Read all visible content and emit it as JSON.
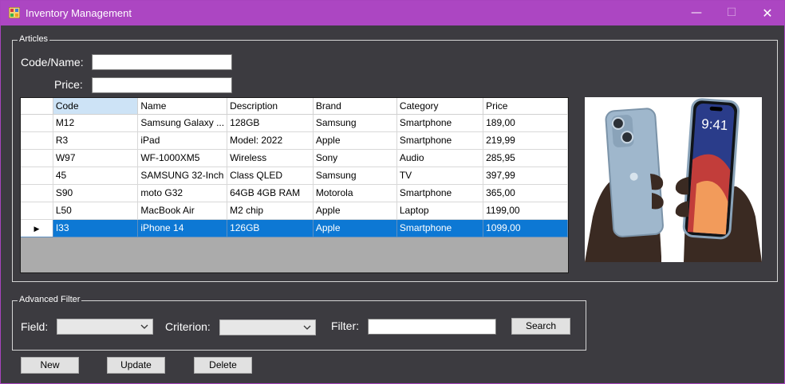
{
  "window": {
    "title": "Inventory Management",
    "controls": {
      "minimize": "—",
      "maximize": "☐",
      "close": "✕"
    }
  },
  "articles": {
    "group_title": "Articles",
    "code_name_label": "Code/Name:",
    "code_name_value": "",
    "price_label": "Price:",
    "price_value": "",
    "grid": {
      "columns": [
        "Code",
        "Name",
        "Description",
        "Brand",
        "Category",
        "Price"
      ],
      "rows": [
        [
          "M12",
          "Samsung Galaxy ...",
          "128GB",
          "Samsung",
          "Smartphone",
          "189,00"
        ],
        [
          "R3",
          "iPad",
          "Model: 2022",
          "Apple",
          "Smartphone",
          "219,99"
        ],
        [
          "W97",
          "WF-1000XM5",
          "Wireless",
          "Sony",
          "Audio",
          "285,95"
        ],
        [
          "45",
          "SAMSUNG 32-Inch",
          "Class QLED",
          "Samsung",
          "TV",
          "397,99"
        ],
        [
          "S90",
          "moto G32",
          "64GB 4GB RAM",
          "Motorola",
          "Smartphone",
          "365,00"
        ],
        [
          "L50",
          "MacBook Air",
          "M2 chip",
          "Apple",
          "Laptop",
          "1199,00"
        ],
        [
          "I33",
          "iPhone 14",
          "126GB",
          "Apple",
          "Smartphone",
          "1099,00"
        ]
      ],
      "selected_row": 6,
      "row_indicator": "▶"
    }
  },
  "filter": {
    "group_title": "Advanced Filter",
    "field_label": "Field:",
    "field_value": "",
    "criterion_label": "Criterion:",
    "criterion_value": "",
    "filter_label": "Filter:",
    "filter_value": "",
    "search_button": "Search"
  },
  "actions": {
    "new": "New",
    "update": "Update",
    "delete": "Delete"
  },
  "colors": {
    "titlebar": "#ac46c2",
    "background": "#3c3b40",
    "selection": "#0d78d4"
  }
}
